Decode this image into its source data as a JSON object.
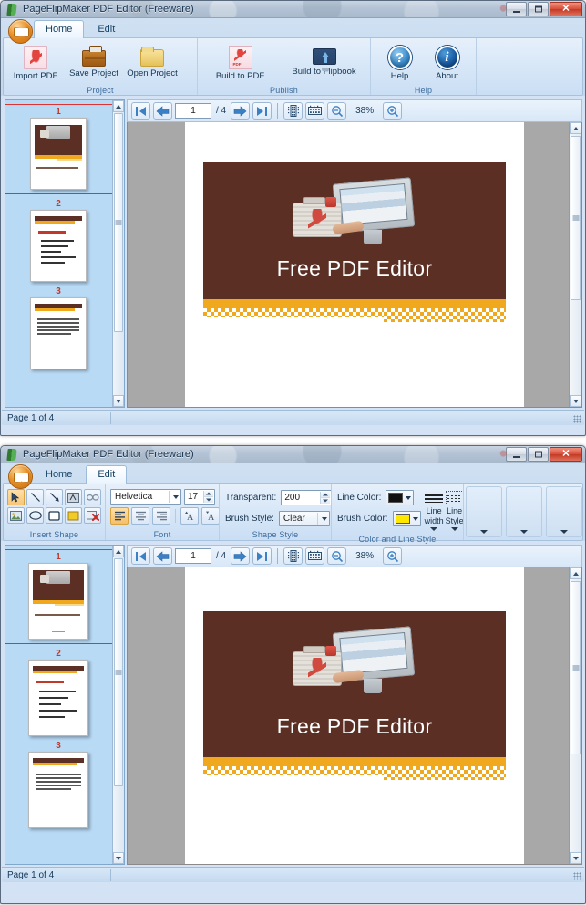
{
  "app": {
    "title": "PageFlipMaker PDF Editor (Freeware)",
    "icon": "book-icon",
    "accent_brown": "#5b2f24",
    "accent_gold": "#f0a91e",
    "select_red": "#cc3333"
  },
  "window_controls": {
    "minimize": "–",
    "maximize": "□",
    "close": "✕"
  },
  "tabs": [
    {
      "label": "Home"
    },
    {
      "label": "Edit"
    }
  ],
  "home_ribbon": {
    "groups": [
      {
        "label": "Project",
        "buttons": [
          {
            "label": "Import PDF",
            "icon": "pdf-document-icon"
          },
          {
            "label": "Save Project",
            "icon": "briefcase-icon"
          },
          {
            "label": "Open Project",
            "icon": "folder-icon"
          }
        ]
      },
      {
        "label": "Publish",
        "buttons": [
          {
            "label": "Build to PDF",
            "icon": "pdf-file-icon"
          },
          {
            "label": "Build to Flipbook",
            "icon": "monitor-upload-icon"
          }
        ]
      },
      {
        "label": "Help",
        "buttons": [
          {
            "label": "Help",
            "icon": "question-circle-icon",
            "glyph": "?"
          },
          {
            "label": "About",
            "icon": "info-circle-icon",
            "glyph": "i"
          }
        ]
      }
    ]
  },
  "edit_ribbon": {
    "groups": {
      "insert_shape": {
        "label": "Insert Shape",
        "tools": [
          {
            "name": "select-tool",
            "icon": "cursor-arrow-icon",
            "active": true
          },
          {
            "name": "line-tool",
            "icon": "line-icon",
            "active": false
          },
          {
            "name": "arrow-tool",
            "icon": "arrow-icon",
            "active": false
          },
          {
            "name": "text-tool",
            "icon": "text-box-icon",
            "active": false
          },
          {
            "name": "link-tool",
            "icon": "link-icon",
            "active": false
          },
          {
            "name": "image-tool",
            "icon": "picture-icon",
            "active": false
          },
          {
            "name": "ellipse-tool",
            "icon": "ellipse-icon",
            "active": false
          },
          {
            "name": "rectangle-tool",
            "icon": "rectangle-icon",
            "active": false
          },
          {
            "name": "fill-rectangle-tool",
            "icon": "filled-rectangle-icon",
            "active": false
          },
          {
            "name": "delete-shape-tool",
            "icon": "delete-icon",
            "active": false
          }
        ]
      },
      "font": {
        "label": "Font",
        "font_family": "Helvetica",
        "font_size": "17",
        "align_left": "align-left-icon",
        "align_center": "align-center-icon",
        "align_right": "align-right-icon",
        "grow_font": "grow-font-icon",
        "shrink_font": "shrink-font-icon"
      },
      "shape_style": {
        "label": "Shape Style",
        "transparent_label": "Transparent:",
        "transparent_value": "200",
        "brush_style_label": "Brush Style:",
        "brush_style_value": "Clear"
      },
      "color_line_style": {
        "label": "Color and Line Style",
        "line_color_label": "Line Color:",
        "line_color_value": "#111111",
        "brush_color_label": "Brush Color:",
        "brush_color_value": "#ffe800",
        "line_width_label_1": "Line",
        "line_width_label_2": "width",
        "line_style_label_1": "Line",
        "line_style_label_2": "Style"
      },
      "overflow": [
        {
          "name": "overflow-group-1"
        },
        {
          "name": "overflow-group-2"
        },
        {
          "name": "overflow-group-3"
        }
      ]
    }
  },
  "navbar": {
    "first_page": "first-page-icon",
    "prev_page": "previous-page-icon",
    "page_value": "1",
    "page_total": "/ 4",
    "next_page": "next-page-icon",
    "last_page": "last-page-icon",
    "single_page_view": "single-page-view-icon",
    "thumbnail_view": "thumbnail-view-icon",
    "zoom_out": "zoom-out-icon",
    "zoom_level": "38%",
    "zoom_in": "zoom-in-icon"
  },
  "thumbnails": [
    {
      "number": "1",
      "selected": true,
      "type": "cover"
    },
    {
      "number": "2",
      "selected": false,
      "type": "bullets"
    },
    {
      "number": "3",
      "selected": false,
      "type": "paragraph"
    }
  ],
  "document": {
    "hero_title": "Free PDF Editor",
    "artwork": "pdf-bag-and-monitor-illustration"
  },
  "statusbar": {
    "text": "Page 1 of 4"
  }
}
